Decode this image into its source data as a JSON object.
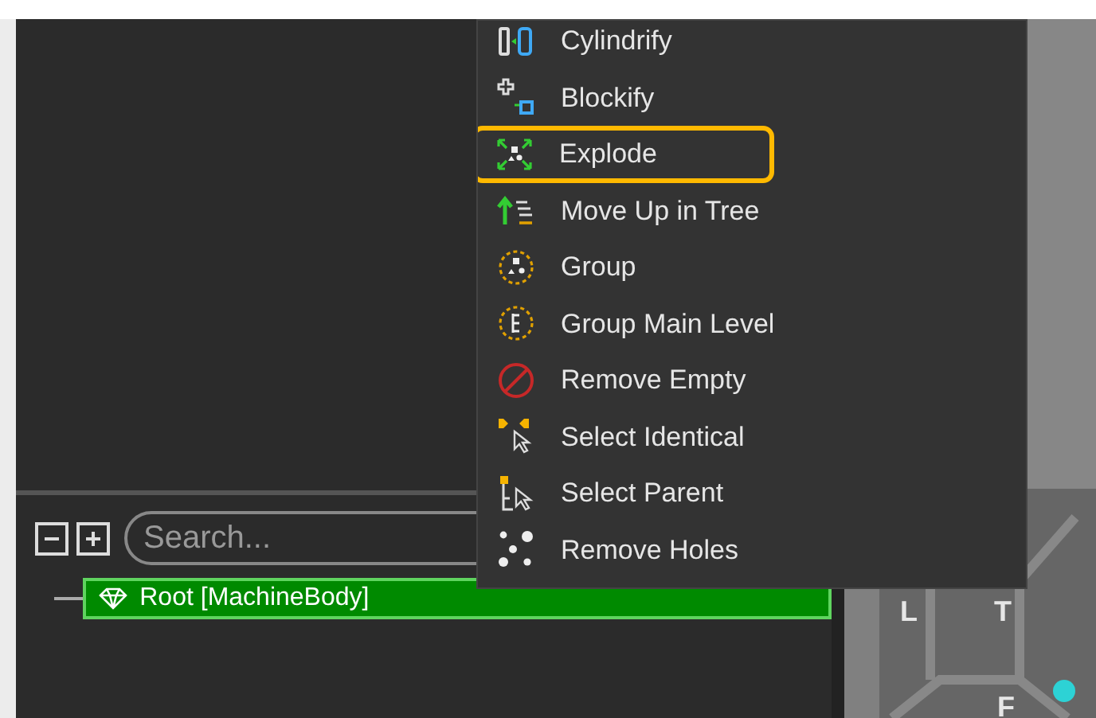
{
  "context_menu": {
    "items": [
      {
        "label": "Cylindrify",
        "highlighted": false
      },
      {
        "label": "Blockify",
        "highlighted": false
      },
      {
        "label": "Explode",
        "highlighted": true
      },
      {
        "label": "Move Up in Tree",
        "highlighted": false
      },
      {
        "label": "Group",
        "highlighted": false
      },
      {
        "label": "Group Main Level",
        "highlighted": false
      },
      {
        "label": "Remove Empty",
        "highlighted": false
      },
      {
        "label": "Select Identical",
        "highlighted": false
      },
      {
        "label": "Select Parent",
        "highlighted": false
      },
      {
        "label": "Remove Holes",
        "highlighted": false
      }
    ]
  },
  "tree_panel": {
    "search": {
      "placeholder": "Search..."
    },
    "items": [
      {
        "label": "Root [MachineBody]",
        "selected": true
      }
    ]
  },
  "view_cube": {
    "faces": [
      "L",
      "T",
      "F"
    ]
  }
}
